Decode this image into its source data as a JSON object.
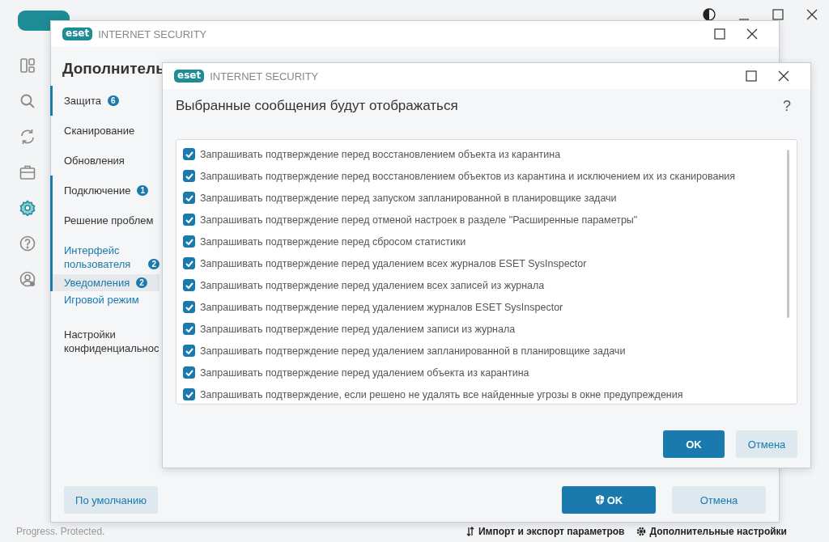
{
  "main_window": {
    "sidebar": [
      {
        "selected": false
      },
      {
        "selected": false
      },
      {
        "selected": false
      },
      {
        "selected": false
      },
      {
        "selected": true
      },
      {
        "selected": false
      },
      {
        "selected": false
      }
    ],
    "status_bar": {
      "text": "Progress. Protected.",
      "links": [
        {
          "label": "Импорт и экспорт параметров"
        },
        {
          "label": "Дополнительные настройки"
        }
      ]
    }
  },
  "settings_window": {
    "logo": "eset",
    "title": "INTERNET SECURITY",
    "heading": "Дополнитель",
    "nav": [
      {
        "label": "Защита",
        "badge": "6",
        "marked": true,
        "highlighted": false,
        "selected": false
      },
      {
        "label": "Сканирование",
        "marked": false,
        "highlighted": false,
        "selected": false
      },
      {
        "label": "Обновления",
        "marked": false,
        "highlighted": false,
        "selected": false
      },
      {
        "label": "Подключение",
        "badge": "1",
        "marked": true,
        "highlighted": false,
        "selected": false
      },
      {
        "label": "Решение проблем",
        "marked": true,
        "highlighted": false,
        "selected": false
      },
      {
        "label": "Интерфейс пользователя",
        "badge": "2",
        "marked": true,
        "highlighted": true,
        "selected": false
      },
      {
        "label": "Уведомления",
        "badge": "2",
        "marked": true,
        "highlighted": true,
        "selected": true
      },
      {
        "label": "Игровой режим",
        "marked": false,
        "highlighted": true,
        "selected": false
      },
      {
        "label": "Настройки конфиденциальнос",
        "marked": false,
        "highlighted": false,
        "selected": false
      }
    ],
    "buttons": [
      {
        "label": "По умолчанию",
        "kind": "secondary"
      },
      {
        "label": "OK",
        "kind": "secure"
      },
      {
        "label": "Отмена",
        "kind": "secondary"
      }
    ]
  },
  "dialog": {
    "logo": "eset",
    "title": "INTERNET SECURITY",
    "heading": "Выбранные сообщения будут отображаться",
    "help": "?",
    "items": [
      {
        "label": "Запрашивать подтверждение перед восстановлением объекта из карантина",
        "checked": true
      },
      {
        "label": "Запрашивать подтверждение перед восстановлением объектов из карантина и исключением их из сканирования",
        "checked": true
      },
      {
        "label": "Запрашивать подтверждение перед запуском запланированной в планировщике задачи",
        "checked": true
      },
      {
        "label": "Запрашивать подтверждение перед отменой настроек в разделе \"Расширенные параметры\"",
        "checked": true
      },
      {
        "label": "Запрашивать подтверждение перед сбросом статистики",
        "checked": true
      },
      {
        "label": "Запрашивать подтверждение перед удалением всех журналов ESET SysInspector",
        "checked": true
      },
      {
        "label": "Запрашивать подтверждение перед удалением всех записей из журнала",
        "checked": true
      },
      {
        "label": "Запрашивать подтверждение перед удалением журналов ESET SysInspector",
        "checked": true
      },
      {
        "label": "Запрашивать подтверждение перед удалением записи из журнала",
        "checked": true
      },
      {
        "label": "Запрашивать подтверждение перед удалением запланированной в планировщике задачи",
        "checked": true
      },
      {
        "label": "Запрашивать подтверждение перед удалением объекта из карантина",
        "checked": true
      },
      {
        "label": "Запрашивать подтверждение, если решено не удалять все найденные угрозы в окне предупреждения",
        "checked": true
      }
    ],
    "buttons": [
      {
        "label": "OK",
        "kind": "primary"
      },
      {
        "label": "Отмена",
        "kind": "secondary"
      }
    ]
  }
}
